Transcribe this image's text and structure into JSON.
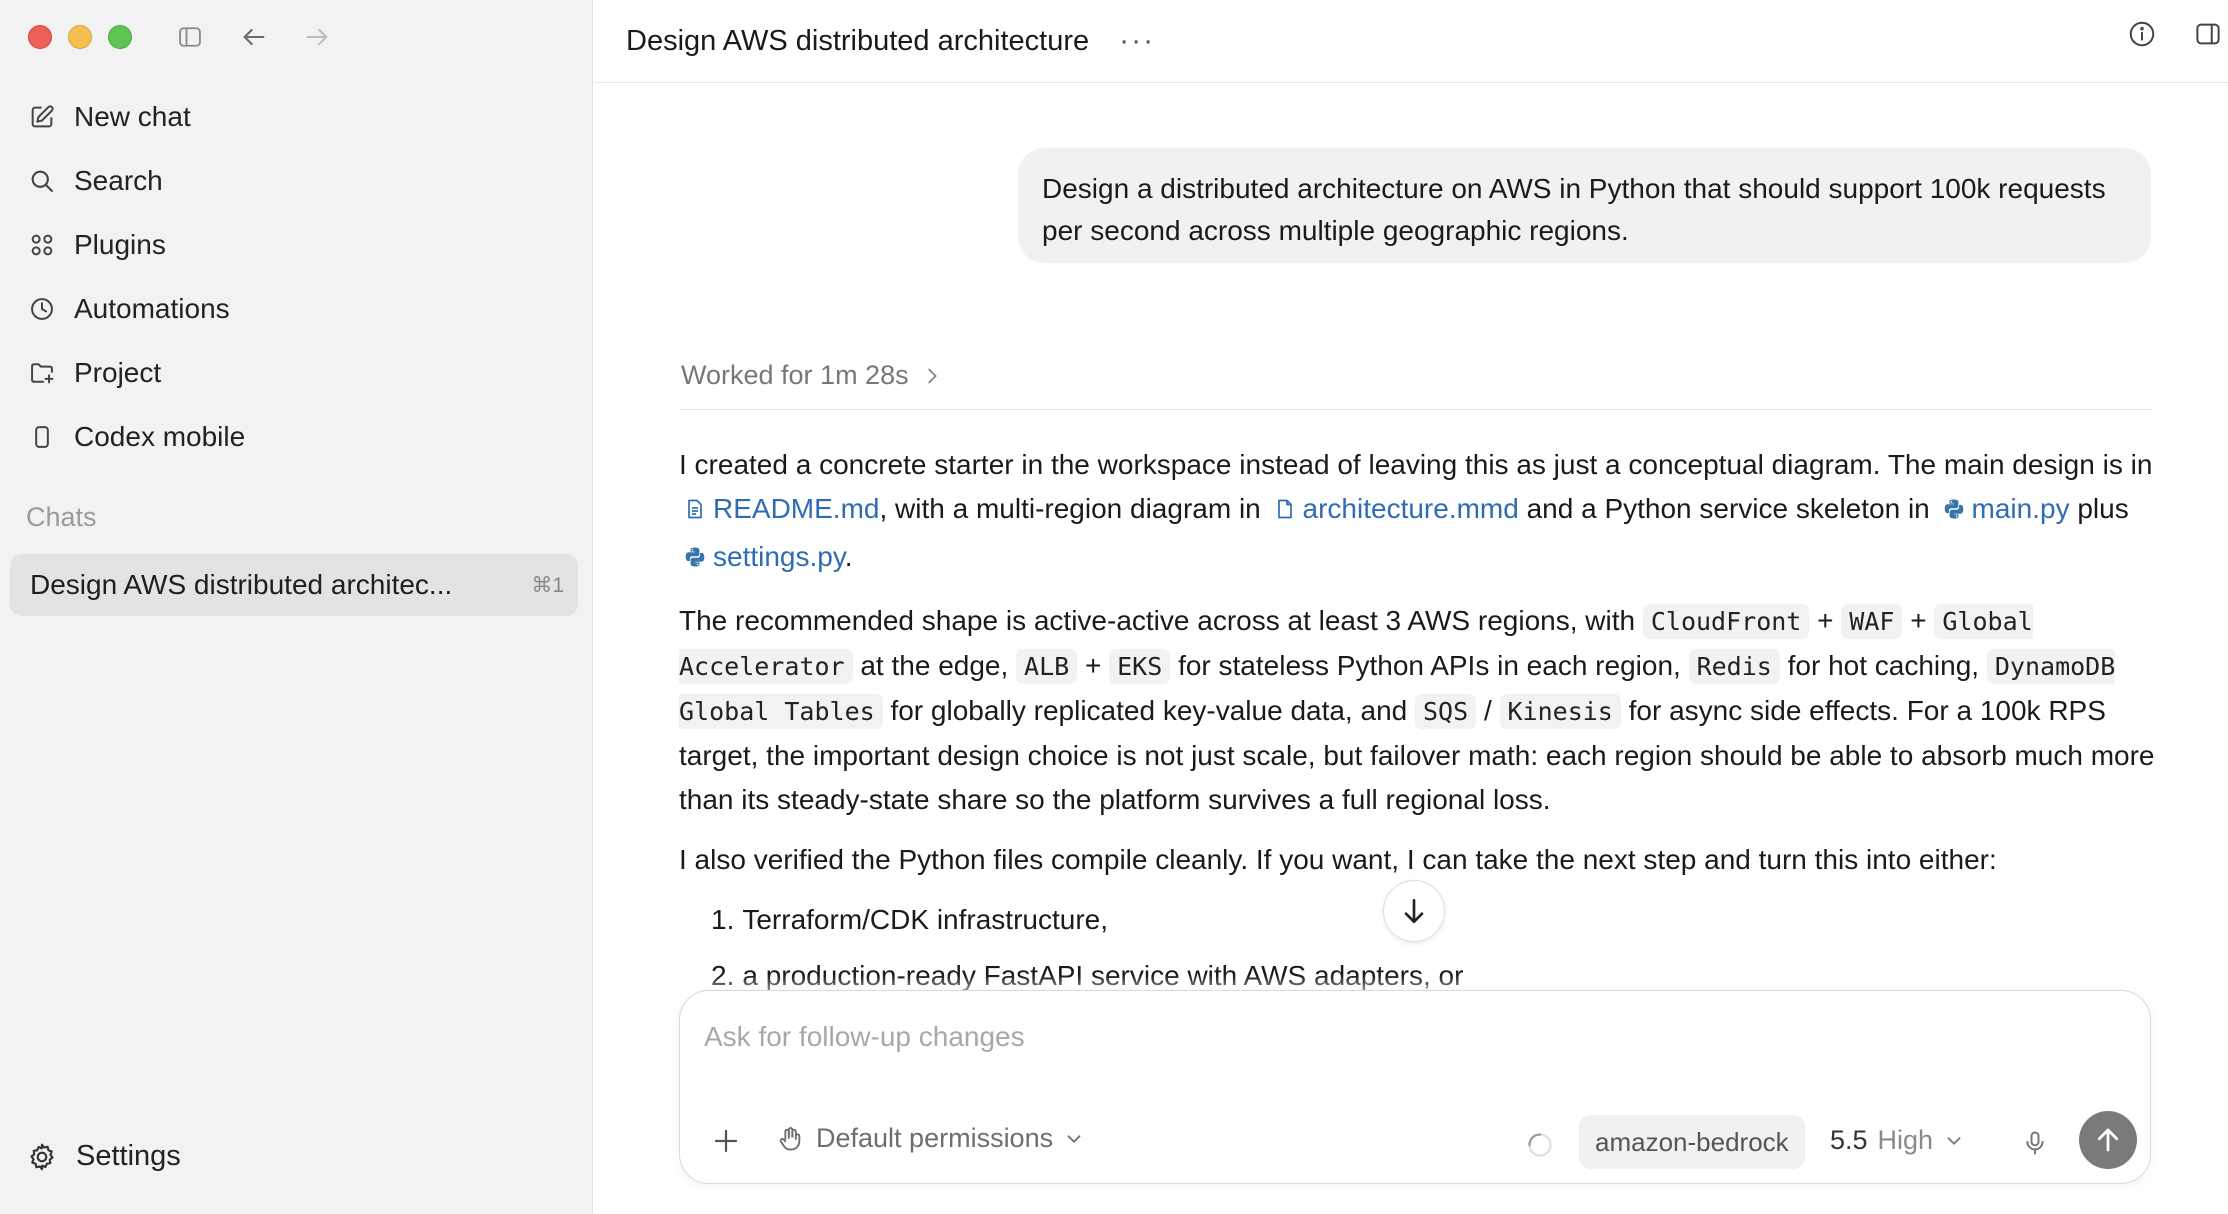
{
  "window": {
    "title": "Design AWS distributed architecture",
    "more_icon": "more-horizontal-icon"
  },
  "sidebar": {
    "items": [
      {
        "label": "New chat",
        "icon": "compose-icon"
      },
      {
        "label": "Search",
        "icon": "search-icon"
      },
      {
        "label": "Plugins",
        "icon": "plugins-icon"
      },
      {
        "label": "Automations",
        "icon": "clock-icon"
      },
      {
        "label": "Project",
        "icon": "folder-add-icon"
      },
      {
        "label": "Codex mobile",
        "icon": "mobile-icon"
      }
    ],
    "section_title": "Chats",
    "chats": [
      {
        "label": "Design AWS distributed architec...",
        "shortcut": "⌘1",
        "active": true
      }
    ],
    "settings_label": "Settings"
  },
  "thread": {
    "user_message": "Design a distributed architecture on AWS in Python that should support 100k requests per second across multiple geographic regions.",
    "worked_label": "Worked for 1m 28s",
    "answer": {
      "p1": {
        "t1": "I created a concrete starter in the workspace instead of leaving this as just a conceptual diagram. The main design is in",
        "f1": "README.md",
        "t2": ", with a multi-region diagram in",
        "f2": "architecture.mmd",
        "t3": "and a Python service skeleton in",
        "f3": "main.py",
        "t4": "plus",
        "f4": "settings.py",
        "t5": "."
      },
      "p2": {
        "t1": "The recommended shape is active-active across at least 3 AWS regions, with",
        "c1": "CloudFront",
        "s1": "+",
        "c2": "WAF",
        "s2": "+",
        "c3": "Global Accelerator",
        "t2": "at the edge,",
        "c4": "ALB",
        "s3": "+",
        "c5": "EKS",
        "t3": "for stateless Python APIs in each region,",
        "c6": "Redis",
        "t4": "for hot caching,",
        "c7": "DynamoDB Global Tables",
        "t5": "for globally replicated key-value data, and",
        "c8": "SQS",
        "s4": "/",
        "c9": "Kinesis",
        "t6": "for async side effects. For a 100k RPS target, the important design choice is not just scale, but failover math: each region should be able to absorb much more than its steady-state share so the platform survives a full regional loss."
      },
      "p3": "I also verified the Python files compile cleanly. If you want, I can take the next step and turn this into either:",
      "list": [
        {
          "num": "1.",
          "text": "Terraform/CDK infrastructure,"
        },
        {
          "num": "2.",
          "text": "a production-ready FastAPI service with AWS adapters, or"
        }
      ]
    }
  },
  "composer": {
    "placeholder": "Ask for follow-up changes",
    "permissions_label": "Default permissions",
    "model": "amazon-bedrock",
    "version": "5.5",
    "effort": "High"
  },
  "colors": {
    "link": "#2f6cb3",
    "sidebar_bg": "#f2f2f2",
    "active_chat_bg": "#e3e3e3",
    "send_bg": "#7a7a7a"
  }
}
